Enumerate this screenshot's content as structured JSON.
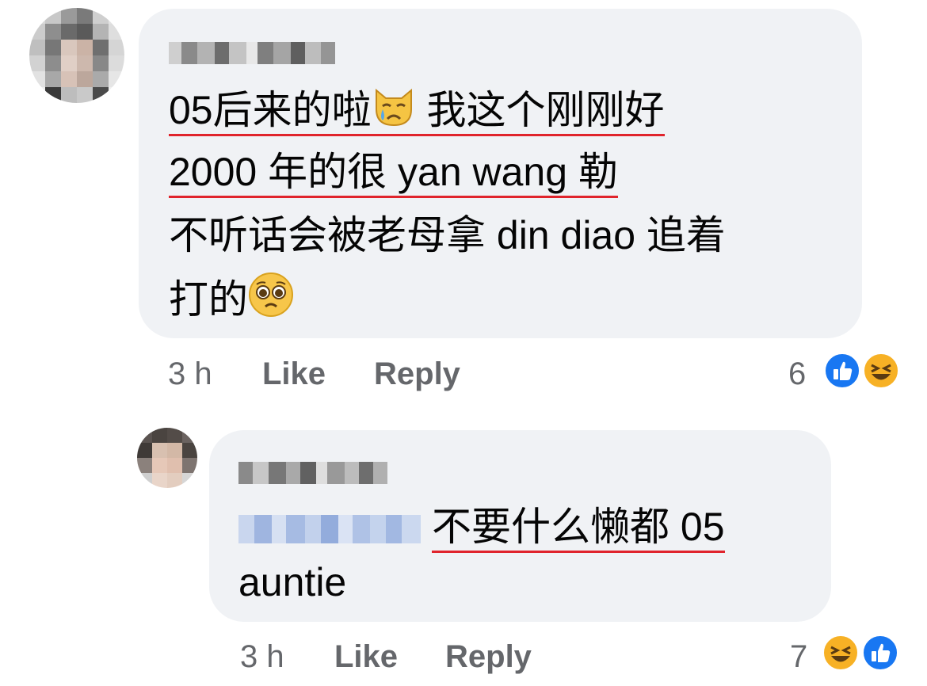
{
  "comment1": {
    "line1": "05后来的啦",
    "line1b": "我这个刚刚好",
    "line2": "2000 年的很 yan wang 勒",
    "line3": "不听话会被老母拿 din diao 追着",
    "line4": "打的",
    "emoji1": "crying-cat-emoji",
    "emoji2": "pleading-face-emoji",
    "time": "3 h",
    "like_label": "Like",
    "reply_label": "Reply",
    "reaction_count": "6"
  },
  "reply1": {
    "line1": "不要什么懒都 05",
    "line2": "auntie",
    "time": "3 h",
    "like_label": "Like",
    "reply_label": "Reply",
    "reaction_count": "7"
  },
  "colors": {
    "bubble": "#f0f2f5",
    "underline": "#e0242c",
    "meta_text": "#65676b",
    "like_blue": "#1877f2",
    "haha_yellow": "#f7b125"
  }
}
